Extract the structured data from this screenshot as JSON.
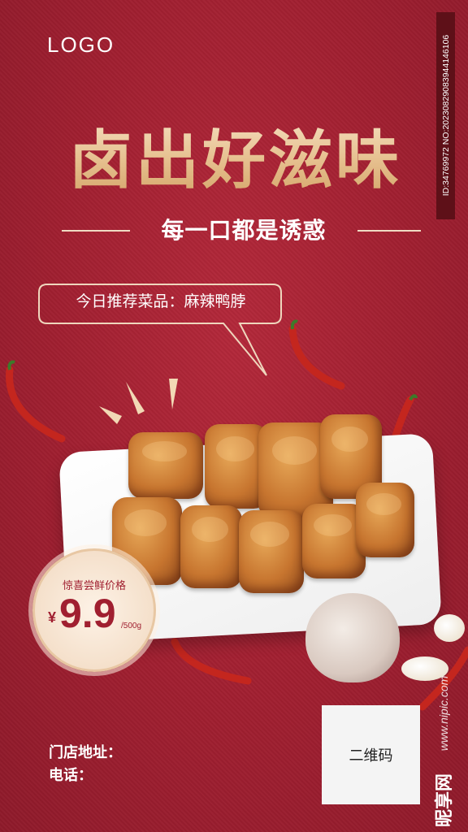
{
  "logo": "LOGO",
  "headline": "卤出好滋味",
  "subtitle": "每一口都是诱惑",
  "recommendation": "今日推荐菜品：麻辣鸭脖",
  "price": {
    "label": "惊喜尝鲜价格",
    "currency": "¥",
    "value": "9.9",
    "unit": "/500g"
  },
  "store_address_label": "门店地址：",
  "phone_label": "电话：",
  "qr_label": "二维码",
  "watermark": {
    "id": "ID:34769972 NO:20230829083944146106",
    "url": "www.nipic.com",
    "brand": "昵享网"
  },
  "colors": {
    "background": "#a01f30",
    "gold": "#e6c08f",
    "price": "#a01f30"
  },
  "icons": [
    "chili-pepper-icon",
    "garlic-icon",
    "qr-code-placeholder"
  ]
}
